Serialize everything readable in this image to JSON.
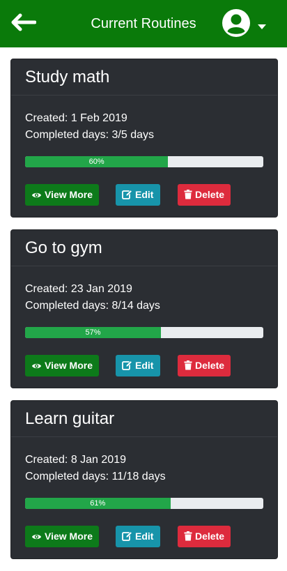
{
  "header": {
    "title": "Current Routines",
    "bg_color": "#0a7a0a",
    "back_icon": "arrow-left-icon",
    "account_icon": "user-circle-icon",
    "dropdown_icon": "caret-down-icon"
  },
  "routines": [
    {
      "name": "Study math",
      "created": "Created: 1 Feb 2019",
      "completed": "Completed days: 3/5 days",
      "progress": 60,
      "progress_label": "60%"
    },
    {
      "name": "Go to gym",
      "created": "Created: 23 Jan 2019",
      "completed": "Completed days: 8/14 days",
      "progress": 57,
      "progress_label": "57%"
    },
    {
      "name": "Learn guitar",
      "created": "Created: 8 Jan 2019",
      "completed": "Completed days: 11/18 days",
      "progress": 61,
      "progress_label": "61%"
    }
  ],
  "actions": {
    "view_more_label": "View More",
    "edit_label": "Edit",
    "delete_label": "Delete",
    "view_icon": "eye-icon",
    "edit_icon": "edit-icon",
    "delete_icon": "trash-icon"
  },
  "colors": {
    "card_bg": "#2b2e33",
    "progress_fill": "#22a649",
    "progress_track": "#e9ecef",
    "view_button": "#0d7a1a",
    "edit_button": "#1794aa",
    "delete_button": "#dd2b3d"
  }
}
